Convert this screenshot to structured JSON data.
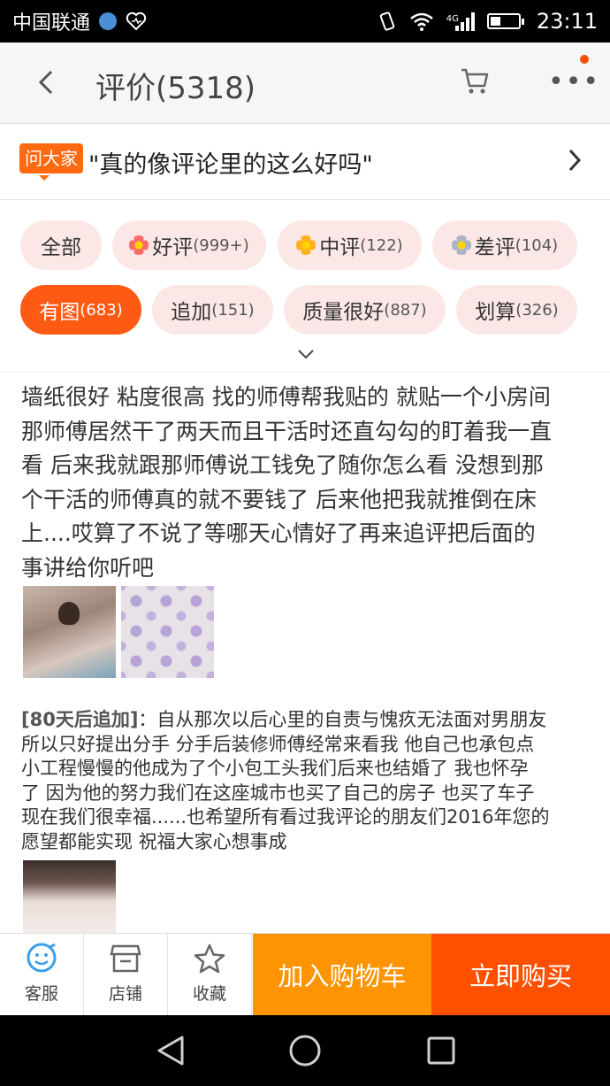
{
  "status_bar": {
    "carrier": "中国联通",
    "network": "4G",
    "time": "23:11"
  },
  "header": {
    "title": "评价(5318)",
    "icons": [
      "back-icon",
      "cart-icon",
      "more-icon"
    ]
  },
  "ask": {
    "badge": "问大家",
    "question": "\"真的像评论里的这么好吗\""
  },
  "tags": [
    {
      "label": "全部",
      "count": ""
    },
    {
      "label": "好评",
      "count": "(999+)"
    },
    {
      "label": "中评",
      "count": "(122)"
    },
    {
      "label": "差评",
      "count": "(104)"
    },
    {
      "label": "有图",
      "count": "(683)"
    },
    {
      "label": "追加",
      "count": "(151)"
    },
    {
      "label": "质量很好",
      "count": "(887)"
    },
    {
      "label": "划算",
      "count": "(326)"
    }
  ],
  "colors": {
    "accent": "#ff5a14",
    "tag_bg": "#fbe8e6",
    "cart_button": "#ff9402",
    "buy_button": "#ff5000"
  },
  "review": {
    "lines": [
      "墙纸很好 粘度很高 找的师傅帮我贴的 就贴一个小房间",
      "那师傅居然干了两天而且干活时还直勾勾的盯着我一直",
      "看 后来我就跟那师傅说工钱免了随你怎么看 没想到那",
      "个干活的师傅真的就不要钱了 后来他把我就推倒在床",
      "上....哎算了不说了等哪天心情好了再来追评把后面的",
      "事讲给你听吧"
    ],
    "followup_label": "[80天后追加]",
    "followup_lines": [
      "：自从那次以后心里的自责与愧疚无法面对男朋友",
      "所以只好提出分手 分手后装修师傅经常来看我 他自己也承包点",
      "小工程慢慢的他成为了个小包工头我们后来也结婚了 我也怀孕",
      "了 因为他的努力我们在这座城市也买了自己的房子 也买了车子",
      "现在我们很幸福......也希望所有看过我评论的朋友们2016年您的",
      "愿望都能实现 祝福大家心想事成"
    ]
  },
  "bottom_bar": {
    "service": "客服",
    "shop": "店铺",
    "favorite": "收藏",
    "add_cart": "加入购物车",
    "buy_now": "立即购买"
  }
}
